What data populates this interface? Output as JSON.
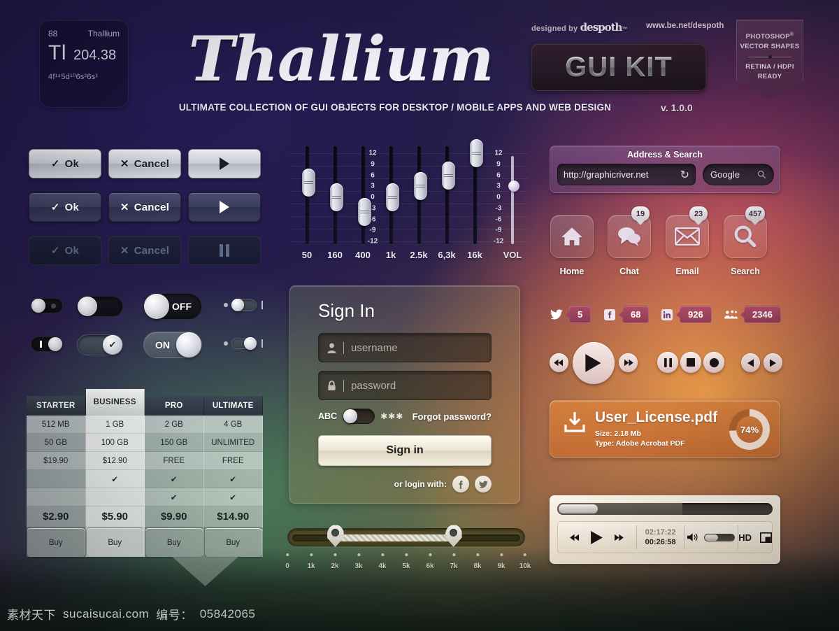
{
  "header": {
    "element": {
      "number": "88",
      "name": "Thallium",
      "symbol": "Tl",
      "mass": "204.38",
      "config": "4f¹⁴5d¹⁰6s²6s¹"
    },
    "wordmark": "Thallium",
    "guikit": "GUI KIT",
    "tagline": "ULTIMATE COLLECTION OF GUI OBJECTS FOR DESKTOP / MOBILE APPS AND WEB DESIGN",
    "version": "v. 1.0.0",
    "designed_by": "designed by",
    "designer": "despoth",
    "designer_tm": "™",
    "portfolio_url": "www.be.net/despoth",
    "badge": {
      "line1": "PHOTOSHOP",
      "reg": "®",
      "line2": "VECTOR SHAPES",
      "line3": "RETINA / HDPI",
      "line4": "READY"
    }
  },
  "buttons": {
    "rows": [
      {
        "style": "light",
        "ok": "Ok",
        "cancel": "Cancel",
        "media": "play"
      },
      {
        "style": "dark",
        "ok": "Ok",
        "cancel": "Cancel",
        "media": "play"
      },
      {
        "style": "disabled",
        "ok": "Ok",
        "cancel": "Cancel",
        "media": "pause"
      }
    ],
    "check_glyph": "✓",
    "x_glyph": "✕"
  },
  "toggles": {
    "off_label": "OFF",
    "on_label": "ON",
    "check_glyph": "✔",
    "bar_glyph": "I"
  },
  "equalizer": {
    "scale": [
      "12",
      "9",
      "6",
      "3",
      "0",
      "-3",
      "-6",
      "-9",
      "-12"
    ],
    "bands": [
      {
        "label": "50",
        "value": 4
      },
      {
        "label": "160",
        "value": 0
      },
      {
        "label": "400",
        "value": -4
      },
      {
        "label": "1k",
        "value": 0
      },
      {
        "label": "2.5k",
        "value": 3
      },
      {
        "label": "6,3k",
        "value": 6
      },
      {
        "label": "16k",
        "value": 12
      }
    ],
    "volume": {
      "label": "VOL",
      "value": 66
    }
  },
  "address_search": {
    "title": "Address & Search",
    "url_value": "http://graphicriver.net",
    "url_placeholder": "http://",
    "engine": "Google",
    "engine_placeholder": "Search"
  },
  "app_icons": [
    {
      "label": "Home",
      "icon": "home-icon",
      "badge": ""
    },
    {
      "label": "Chat",
      "icon": "chat-icon",
      "badge": "19"
    },
    {
      "label": "Email",
      "icon": "email-icon",
      "badge": "23"
    },
    {
      "label": "Search",
      "icon": "search-icon",
      "badge": "457"
    }
  ],
  "social": [
    {
      "network": "twitter",
      "count": "5"
    },
    {
      "network": "facebook",
      "count": "68"
    },
    {
      "network": "linkedin",
      "count": "926"
    },
    {
      "network": "myspace",
      "count": "2346"
    }
  ],
  "media_controls": {
    "rewind": "rewind-icon",
    "play": "play-icon",
    "forward": "forward-icon",
    "pause": "pause-icon",
    "stop": "stop-icon",
    "record": "record-icon",
    "prev": "prev-icon",
    "next": "next-icon"
  },
  "download": {
    "filename": "User_License.pdf",
    "size": "Size: 2.18 Mb",
    "type": "Type: Adobe Acrobat PDF",
    "percent": "74%",
    "percent_value": 74
  },
  "video_player": {
    "current_time": "02:17:22",
    "total_time": "00:26:58",
    "hd_label": "HD",
    "fullscreen": "fullscreen-icon",
    "progress_buffered": 58,
    "progress_played": 17
  },
  "pricing": {
    "plans": [
      "STARTER",
      "BUSINESS",
      "PRO",
      "ULTIMATE"
    ],
    "featured_index": 1,
    "rows": [
      [
        "512 MB",
        "1 GB",
        "2 GB",
        "4 GB"
      ],
      [
        "50 GB",
        "100 GB",
        "150 GB",
        "UNLIMITED"
      ],
      [
        "$19.90",
        "$12.90",
        "FREE",
        "FREE"
      ],
      [
        "",
        "✔",
        "✔",
        "✔"
      ],
      [
        "",
        "",
        "✔",
        "✔"
      ],
      [
        "$2.90",
        "$5.90",
        "$9.90",
        "$14.90"
      ]
    ],
    "buy_label": "Buy"
  },
  "sign_in": {
    "title": "Sign In",
    "username_placeholder": "username",
    "password_placeholder": "password",
    "abc_label": "ABC",
    "stars": "✱✱✱",
    "forgot": "Forgot password?",
    "submit": "Sign in",
    "or_login": "or login with:",
    "providers": [
      "facebook",
      "twitter"
    ]
  },
  "range_slider": {
    "ticks": [
      "0",
      "1k",
      "2k",
      "3k",
      "4k",
      "5k",
      "6k",
      "7k",
      "8k",
      "9k",
      "10k"
    ],
    "handle_low": "2k",
    "handle_high": "7k",
    "min": 0,
    "max": 10
  },
  "watermark": {
    "cn": "素材天下",
    "site": "sucaisucai.com",
    "id_label": "编号：",
    "id": "05842065"
  },
  "colors": {
    "accent_purple": "#4a3159",
    "accent_orange": "#d6803e",
    "accent_green": "#4a8a5c",
    "accent_pink": "#c6467 0"
  }
}
